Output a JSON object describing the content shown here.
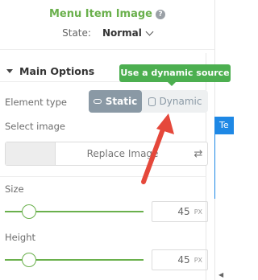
{
  "panel": {
    "title": "Menu Item Image",
    "state_label": "State:",
    "state_value": "Normal"
  },
  "main_options": {
    "title": "Main Options",
    "element_type_label": "Element type",
    "element_type_options": [
      "Static",
      "Dynamic"
    ],
    "element_type_selected": "Static",
    "tooltip": "Use a dynamic source",
    "select_image_label": "Select image",
    "replace_image_label": "Replace Image",
    "size": {
      "label": "Size",
      "value": "45",
      "unit": "PX"
    },
    "height": {
      "label": "Height",
      "value": "45",
      "unit": "PX"
    }
  },
  "canvas_tag": "Te",
  "colors": {
    "accent_green": "#6ab04c",
    "tooltip_green": "#4caf50",
    "static_toggle": "#8a99a5",
    "arrow_red": "#e5483b",
    "canvas_blue": "#1e88e5"
  },
  "icons": [
    "help-icon",
    "chevron-down-icon",
    "caret-icon",
    "link-icon",
    "database-icon",
    "swap-icon"
  ]
}
